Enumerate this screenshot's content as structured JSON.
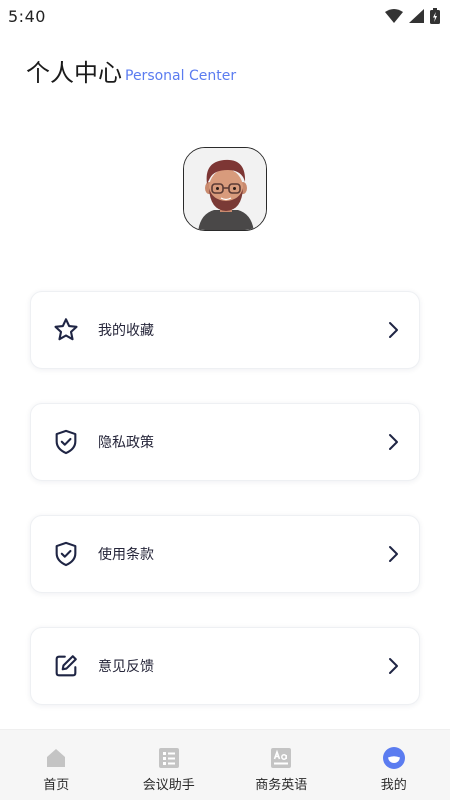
{
  "status_bar": {
    "time": "5:40"
  },
  "header": {
    "title": "个人中心",
    "subtitle": "Personal Center"
  },
  "menu": [
    {
      "label": "我的收藏",
      "icon": "star-icon"
    },
    {
      "label": "隐私政策",
      "icon": "shield-check-icon"
    },
    {
      "label": "使用条款",
      "icon": "shield-check-icon"
    },
    {
      "label": "意见反馈",
      "icon": "edit-icon"
    }
  ],
  "bottom_nav": [
    {
      "label": "首页",
      "icon": "home-icon"
    },
    {
      "label": "会议助手",
      "icon": "list-icon"
    },
    {
      "label": "商务英语",
      "icon": "dictionary-icon"
    },
    {
      "label": "我的",
      "icon": "profile-icon",
      "active": true
    }
  ],
  "colors": {
    "accent": "#5b7cf0",
    "icon_dark": "#1f2544",
    "nav_inactive": "#c4c4c4",
    "nav_active": "#5b7cf0"
  }
}
